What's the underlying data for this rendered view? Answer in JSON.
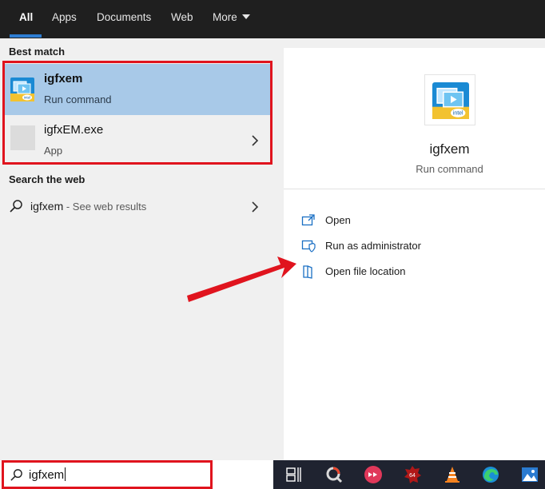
{
  "tabs": [
    {
      "label": "All",
      "active": true
    },
    {
      "label": "Apps"
    },
    {
      "label": "Documents"
    },
    {
      "label": "Web"
    },
    {
      "label": "More"
    }
  ],
  "best_match": {
    "heading": "Best match",
    "items": [
      {
        "title": "igfxem",
        "subtitle": "Run command",
        "icon": "intel-app-icon",
        "selected": true
      },
      {
        "title": "igfxEM.exe",
        "subtitle": "App",
        "icon": "generic-app-icon"
      }
    ]
  },
  "web": {
    "heading": "Search the web",
    "query": "igfxem",
    "hint": " - See web results"
  },
  "preview": {
    "title": "igfxem",
    "subtitle": "Run command",
    "actions": [
      {
        "label": "Open",
        "icon": "open-icon"
      },
      {
        "label": "Run as administrator",
        "icon": "shield-icon"
      },
      {
        "label": "Open file location",
        "icon": "folder-location-icon"
      }
    ]
  },
  "search": {
    "value": "igfxem"
  },
  "taskbar_icons": [
    "task-view-icon",
    "search-app-icon",
    "media-app-icon",
    "cpu-z-icon",
    "vlc-icon",
    "edge-icon",
    "photos-icon"
  ],
  "colors": {
    "accent": "#2d7dd2",
    "selection": "#a8c9e8",
    "annotation_red": "#e0141e",
    "tabbar": "#1f1f1f",
    "taskbar": "#1f2330"
  }
}
